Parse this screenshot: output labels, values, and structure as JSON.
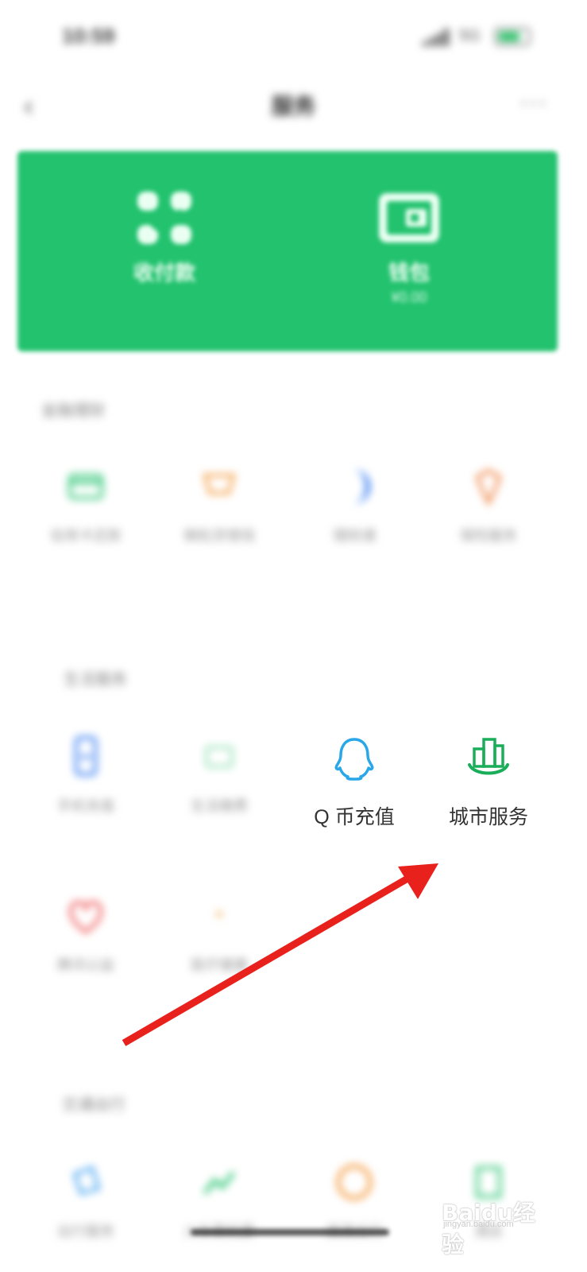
{
  "status_bar": {
    "time": "10:59",
    "network": "5G"
  },
  "nav": {
    "back_glyph": "‹",
    "title": "服务",
    "more_glyph": "···"
  },
  "banner": {
    "color": "#22c26e",
    "items": [
      {
        "icon": "scan-icon",
        "label": "收付款"
      },
      {
        "icon": "wallet-icon",
        "label": "钱包",
        "sub": "¥0.00"
      }
    ]
  },
  "sections": [
    {
      "title": "金融理财",
      "items": [
        {
          "icon": "credit-card-icon",
          "label": "信用卡还款"
        },
        {
          "icon": "loan-icon",
          "label": "微粒贷借钱"
        },
        {
          "icon": "moon-icon",
          "label": "理财通"
        },
        {
          "icon": "insurance-icon",
          "label": "保险服务"
        }
      ]
    },
    {
      "title": "生活服务",
      "items": [
        {
          "icon": "phone-topup-icon",
          "label": "手机充值"
        },
        {
          "icon": "utilities-icon",
          "label": "生活缴费"
        },
        {
          "icon": "qq-penguin-icon",
          "label": "Q 币充值",
          "color": "#2aa7e8"
        },
        {
          "icon": "city-buildings-icon",
          "label": "城市服务",
          "color": "#1aad5a"
        },
        {
          "icon": "heart-icon",
          "label": "腾讯公益"
        },
        {
          "icon": "medical-icon",
          "label": "医疗健康"
        }
      ]
    },
    {
      "title": "交通出行",
      "items": [
        {
          "icon": "train-icon",
          "label": "出行服务"
        },
        {
          "icon": "ticket-icon",
          "label": "火车票机票"
        },
        {
          "icon": "taxi-icon",
          "label": "滴滴出行"
        },
        {
          "icon": "hotel-icon",
          "label": "酒店"
        }
      ]
    }
  ],
  "watermark": {
    "text": "Baidu经验",
    "sub": "jingyan.baidu.com"
  },
  "arrow_color": "#e8211c"
}
